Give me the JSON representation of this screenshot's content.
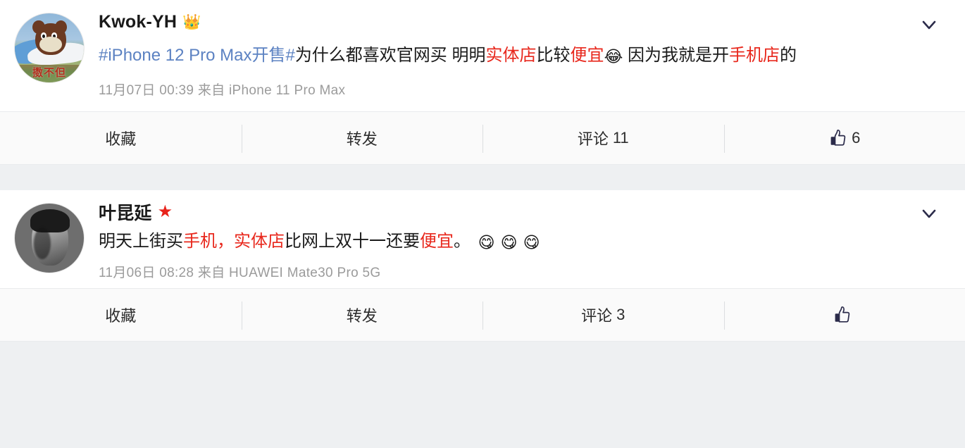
{
  "theme": {
    "page_bg": "#eef0f2",
    "card_bg": "#ffffff",
    "action_bar_bg": "#fafafa",
    "link_blue": "#5c82c2",
    "highlight_red": "#e8281d",
    "star_red": "#e8231b",
    "meta_gray": "#9b9b9b",
    "text_dark": "#1a1a1a",
    "divider": "#dcdee0"
  },
  "posts": [
    {
      "username": "Kwok-YH",
      "badge_icon": "crown-icon",
      "badge_glyph": "👑",
      "avatar_name": "cartoon-mouse-avatar",
      "avatar_caption": "擞不但",
      "text": {
        "hashtag": "#iPhone 12 Pro Max开售#",
        "seg1": "为什么都喜欢官网买 明明",
        "hl1": "实体店",
        "seg2": "比较",
        "hl2": "便宜",
        "emoji1": "😂",
        "seg3": " 因为我就是开",
        "hl3": "手机店",
        "seg4": "的"
      },
      "meta": "11月07日 00:39  来自 iPhone 11 Pro Max",
      "actions": {
        "favorite_label": "收藏",
        "repost_label": "转发",
        "comment_label": "评论",
        "comment_count": "11",
        "like_count": "6"
      },
      "collapse_icon": "chevron-down-icon"
    },
    {
      "username": "叶昆延",
      "badge_icon": "star-icon",
      "badge_glyph": "★",
      "avatar_name": "portrait-photo-avatar",
      "text": {
        "seg1": "明天上街买",
        "hl1": "手机",
        "seg2": "，",
        "hl2": "实体店",
        "seg3": "比网上双十一还要",
        "hl3": "便宜",
        "seg4": "。 ",
        "emoji1": "😋",
        "emoji2": "😋",
        "emoji3": "😋"
      },
      "meta": "11月06日 08:28  来自 HUAWEI Mate30 Pro 5G",
      "actions": {
        "favorite_label": "收藏",
        "repost_label": "转发",
        "comment_label": "评论",
        "comment_count": "3",
        "like_count": ""
      },
      "collapse_icon": "chevron-down-icon"
    }
  ]
}
